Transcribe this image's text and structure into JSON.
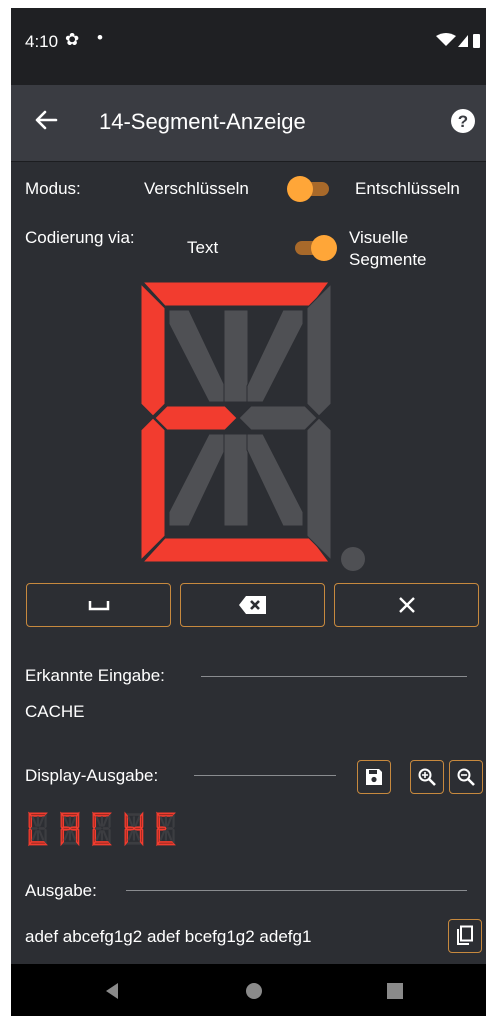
{
  "status_bar": {
    "time": "4:10"
  },
  "app_bar": {
    "title": "14-Segment-Anzeige",
    "back_icon": "arrow-back-icon",
    "help_icon": "help-circle-icon"
  },
  "mode": {
    "label": "Modus:",
    "option_left": "Verschlüsseln",
    "option_right": "Entschlüsseln",
    "selected": "Verschlüsseln"
  },
  "encoding": {
    "label": "Codierung via:",
    "option_left": "Text",
    "option_right": "Visuelle Segmente",
    "selected": "Visuelle Segmente"
  },
  "segment_display": {
    "active_segments": [
      "a",
      "d",
      "e",
      "f",
      "g1"
    ],
    "active_color": "#f23c2f",
    "inactive_color": "#4f5054"
  },
  "keypad": [
    {
      "icon": "space-bar-icon"
    },
    {
      "icon": "backspace-icon"
    },
    {
      "icon": "clear-icon"
    }
  ],
  "recognized_input": {
    "label": "Erkannte Eingabe:",
    "value": "CACHE"
  },
  "display_output": {
    "label": "Display-Ausgabe:",
    "icons": [
      "save-icon",
      "zoom-in-icon",
      "zoom-out-icon"
    ],
    "characters": [
      "C",
      "A",
      "C",
      "H",
      "E"
    ]
  },
  "output": {
    "label": "Ausgabe:",
    "value": "adef abcefg1g2 adef bcefg1g2 adefg1",
    "icon": "copy-icon"
  },
  "colors": {
    "accent": "#ffa638",
    "background": "#2c2e33",
    "app_bar": "#3a3c42"
  }
}
